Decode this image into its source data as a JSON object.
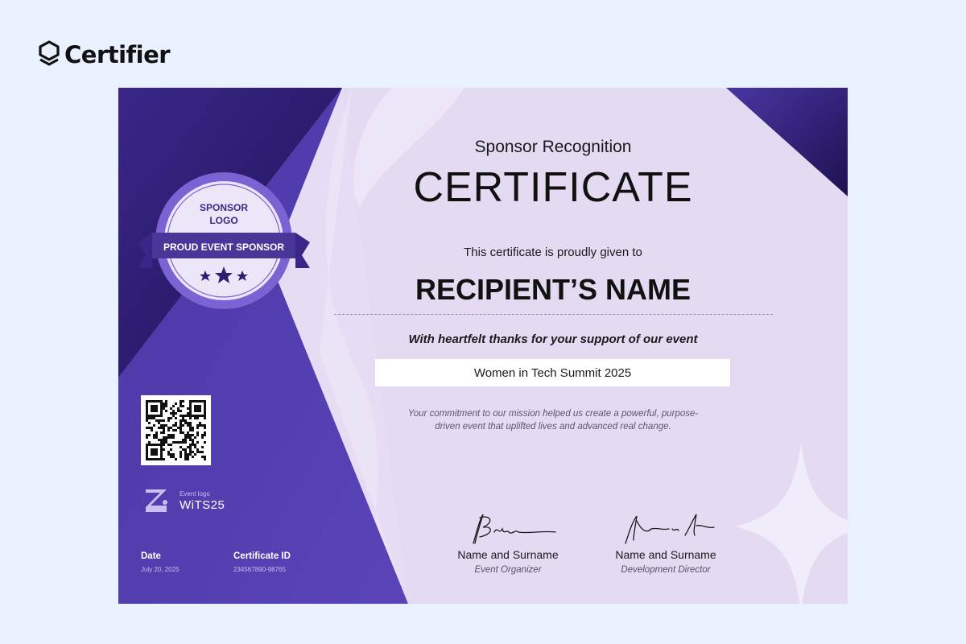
{
  "brand": {
    "name": "Certifier",
    "icon": "shield-logo-icon"
  },
  "certificate": {
    "subtitle": "Sponsor Recognition",
    "title": "CERTIFICATE",
    "given_to": "This certificate is proudly given to",
    "recipient": "RECIPIENT’S NAME",
    "thanks": "With heartfelt thanks for your support of our event",
    "event": "Women in Tech Summit 2025",
    "description_line1": "Your commitment to our mission helped us create a powerful, purpose-",
    "description_line2": "driven event that uplifted lives and advanced real change."
  },
  "badge": {
    "logo_line1": "SPONSOR",
    "logo_line2": "LOGO",
    "ribbon": "PROUD EVENT SPONSOR"
  },
  "event_logo": {
    "small_label": "Event logo",
    "name": "WiTS25"
  },
  "meta": {
    "date_label": "Date",
    "date_value": "July 20, 2025",
    "id_label": "Certificate ID",
    "id_value": "234567890-98765"
  },
  "signatures": [
    {
      "name": "Name and Surname",
      "role": "Event Organizer"
    },
    {
      "name": "Name and Surname",
      "role": "Development Director"
    }
  ],
  "colors": {
    "page_bg": "#e8f1fd",
    "certificate_bg": "#e6dcf3",
    "deep_purple": "#2e1d6e",
    "violet": "#4d38a8",
    "badge_purple": "#7b63d4"
  }
}
